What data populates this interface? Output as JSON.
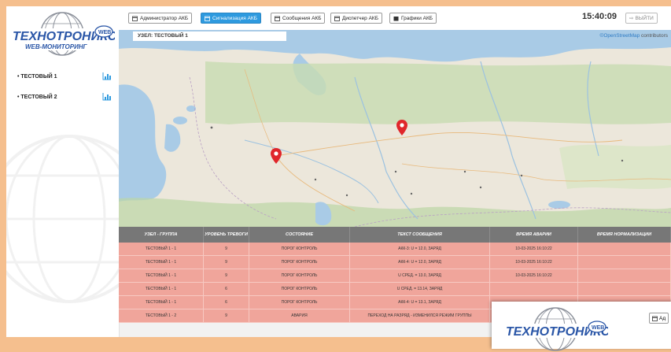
{
  "logo": {
    "line1": "ТЕХНОТРОНИКС",
    "line2": "WEB-МОНИТОРИНГ",
    "badge": "WEB"
  },
  "sidebar": {
    "items": [
      {
        "label": "• ТЕСТОВЫЙ 1",
        "icon": "bar-chart-icon"
      },
      {
        "label": "• ТЕСТОВЫЙ 2",
        "icon": "bar-chart-icon"
      }
    ]
  },
  "toolbar": {
    "buttons": [
      {
        "label": "Администратор АКБ",
        "icon": "calendar-icon",
        "active": false
      },
      {
        "label": "Сигнализация АКБ",
        "icon": "calendar-icon",
        "active": true
      },
      {
        "label": "Сообщения АКБ",
        "icon": "calendar-icon",
        "active": false
      },
      {
        "label": "Диспетчер АКБ",
        "icon": "calendar-icon",
        "active": false
      },
      {
        "label": "Графики АКБ",
        "icon": "square-icon",
        "active": false
      }
    ],
    "time": "15:40:09",
    "exit_label": "ВЫЙТИ"
  },
  "map": {
    "node_label": "УЗЕЛ: ТЕСТОВЫЙ 1",
    "attribution_link": "©OpenStreetMap",
    "attribution_text": " contributors",
    "colors": {
      "marker": "#e0262b",
      "water": "#a9cbe6",
      "land": "#e9e4d8",
      "forest": "#b9d3a0"
    }
  },
  "table": {
    "headers": [
      "УЗЕЛ - ГРУППА",
      "УРОВЕНЬ ТРЕВОГИ",
      "СОСТОЯНИЕ",
      "ТЕКСТ СООБЩЕНИЯ",
      "ВРЕМЯ АВАРИИ",
      "ВРЕМЯ НОРМАЛИЗАЦИИ"
    ],
    "rows": [
      [
        "ТЕСТОВЫЙ 1 - 1",
        "9",
        "ПОРОГ КОНТРОЛЬ",
        "АКК-3: U = 12.0, ЗАРЯД",
        "10-03-2025 16:10:22",
        ""
      ],
      [
        "ТЕСТОВЫЙ 1 - 1",
        "9",
        "ПОРОГ КОНТРОЛЬ",
        "АКК-4: U = 12.0, ЗАРЯД",
        "10-03-2025 16:10:22",
        ""
      ],
      [
        "ТЕСТОВЫЙ 1 - 1",
        "9",
        "ПОРОГ КОНТРОЛЬ",
        "U СРЕД. = 13.0, ЗАРЯД",
        "10-03-2025 16:10:22",
        ""
      ],
      [
        "ТЕСТОВЫЙ 1 - 1",
        "6",
        "ПОРОГ КОНТРОЛЬ",
        "U СРЕД. = 13.14, ЗАРЯД",
        "",
        ""
      ],
      [
        "ТЕСТОВЫЙ 1 - 1",
        "6",
        "ПОРОГ КОНТРОЛЬ",
        "АКК-4: U = 13.1, ЗАРЯД",
        "",
        ""
      ],
      [
        "ТЕСТОВЫЙ 1 - 2",
        "9",
        "АВАРИЯ",
        "ПЕРЕХОД НА РАЗРЯД - ИЗМЕНИЛСЯ РЕЖИМ ГРУППЫ",
        "",
        ""
      ]
    ]
  },
  "overlay": {
    "button_label": "Ад"
  }
}
